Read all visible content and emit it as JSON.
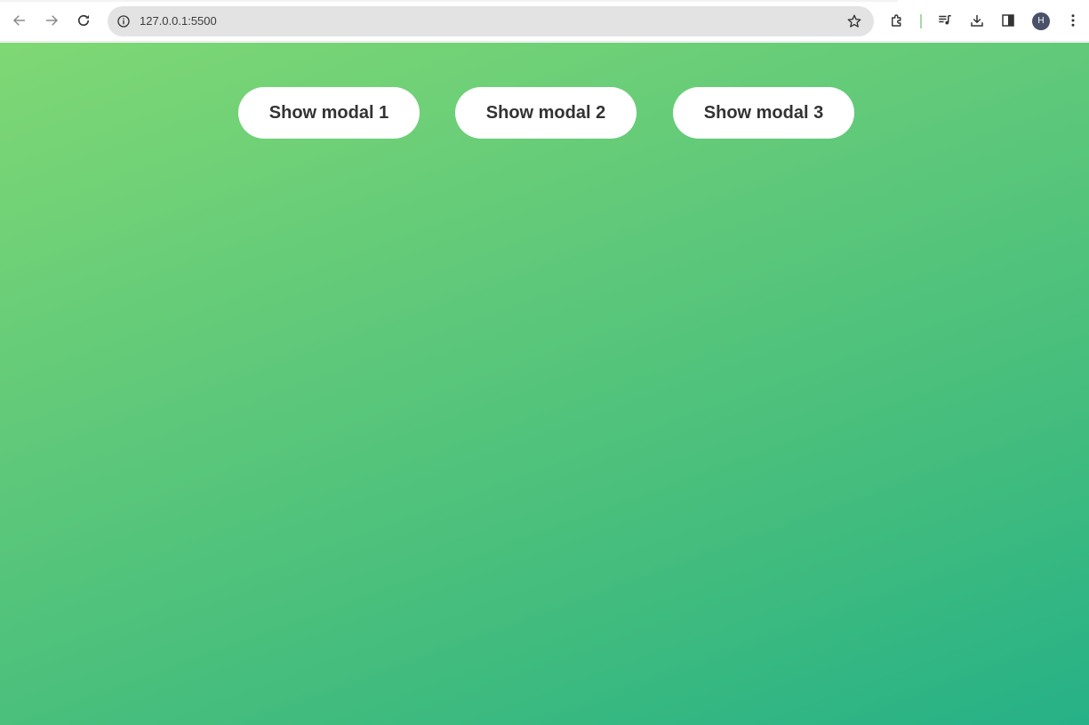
{
  "browser": {
    "url": "127.0.0.1:5500",
    "profile_initial": "H",
    "icons": {
      "back": "back-arrow-icon",
      "forward": "forward-arrow-icon",
      "reload": "reload-icon",
      "site_info": "info-icon",
      "bookmark": "star-icon",
      "extensions": "puzzle-icon",
      "media": "media-queue-icon",
      "downloads": "download-icon",
      "side_panel": "side-panel-icon",
      "menu": "kebab-menu-icon"
    }
  },
  "page": {
    "background_gradient": [
      "#7fd874",
      "#26b187"
    ],
    "buttons": [
      {
        "label": "Show modal 1"
      },
      {
        "label": "Show modal 2"
      },
      {
        "label": "Show modal 3"
      }
    ]
  }
}
